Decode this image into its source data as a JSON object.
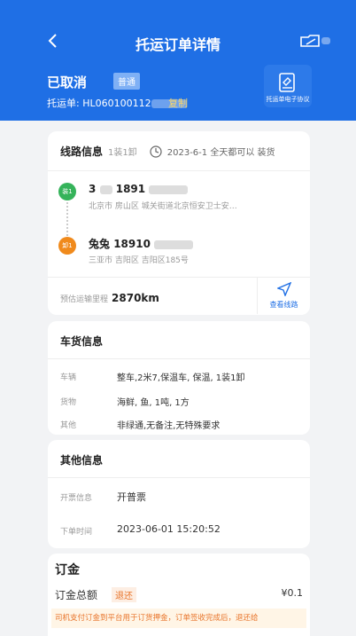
{
  "header": {
    "title": "托运订单详情",
    "status": "已取消",
    "badge": "普通",
    "order_no_label": "托运单:",
    "order_no": "HL060100112",
    "copy_label": "复制",
    "protocol_label": "托运单电子协议",
    "accent": "#1f6fe5"
  },
  "route": {
    "title": "线路信息",
    "sub": "1装1卸",
    "date": "2023-6-1 全天都可以 装货",
    "load_badge": "装1",
    "unload_badge": "卸1",
    "load_name": "3",
    "load_phone": "1891",
    "load_addr": "北京市 房山区 城关街道北京恒安卫士安…",
    "unload_name": "兔兔",
    "unload_phone": "18910",
    "unload_addr": "三亚市 吉阳区 吉阳区185号",
    "mileage_label": "预估运输里程",
    "mileage_value": "2870km",
    "view_route": "查看线路"
  },
  "cargo": {
    "title": "车货信息",
    "vehicle_label": "车辆",
    "vehicle_value": "整车,2米7,保温车, 保温, 1装1卸",
    "goods_label": "货物",
    "goods_value": "海鲜, 鱼, 1吨, 1方",
    "other_label": "其他",
    "other_value": "非绿通,无备注,无特殊要求"
  },
  "other": {
    "title": "其他信息",
    "invoice_label": "开票信息",
    "invoice_value": "开普票",
    "time_label": "下单时间",
    "time_value": "2023-06-01 15:20:52"
  },
  "deposit": {
    "title": "订金",
    "total_label": "订金总额",
    "refund_tag": "退还",
    "amount": "¥0.1",
    "note": "司机支付订金到平台用于订货押金，订单签收完成后，退还给"
  }
}
